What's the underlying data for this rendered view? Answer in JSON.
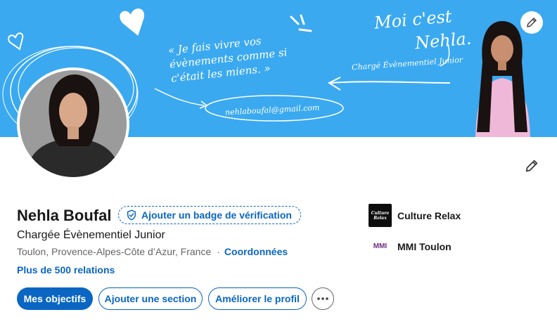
{
  "banner": {
    "quote": "« Je fais vivre vos évènements comme si c'était les miens. »",
    "greeting": "Moi c'est",
    "name": "Nehla.",
    "role": "Chargé Évènementiel Junior",
    "email": "nehlaboufal@gmail.com",
    "bg_color": "#3aa9f0"
  },
  "profile": {
    "name": "Nehla Boufal",
    "verify_badge": "Ajouter un badge de vérification",
    "headline": "Chargée Évènementiel Junior",
    "location": "Toulon, Provence-Alpes-Côte d’Azur, France",
    "contact": "Coordonnées",
    "connections": "Plus de 500 relations"
  },
  "actions": {
    "primary": "Mes objectifs",
    "add_section": "Ajouter une section",
    "improve": "Améliorer le profil",
    "more": "···"
  },
  "organizations": [
    {
      "name": "Culture Relax",
      "logo_text": "Culture Relax"
    },
    {
      "name": "MMI Toulon",
      "logo_text": "MMI"
    }
  ],
  "colors": {
    "accent": "#0a66c2",
    "text": "#191919",
    "muted": "#666666"
  }
}
